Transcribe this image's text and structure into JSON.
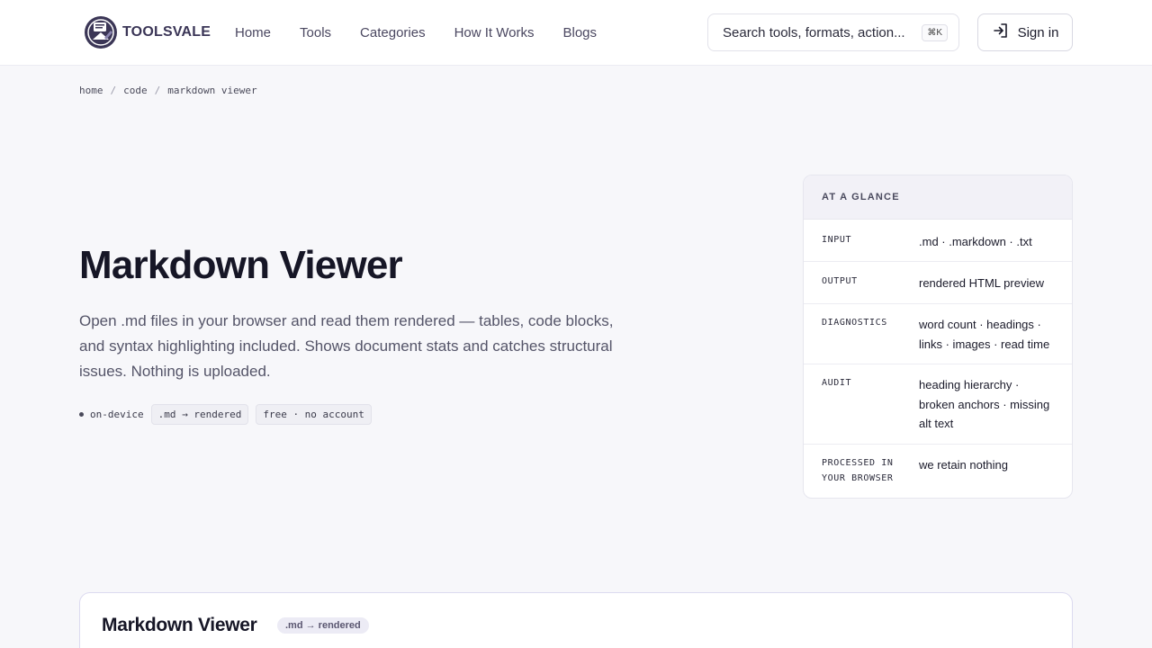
{
  "header": {
    "logo_text": "TOOLSVALE",
    "nav": [
      "Home",
      "Tools",
      "Categories",
      "How It Works",
      "Blogs"
    ],
    "search_placeholder": "Search tools, formats, action...",
    "search_shortcut": "⌘K",
    "signin_label": "Sign in"
  },
  "breadcrumb": [
    "home",
    "code",
    "markdown viewer"
  ],
  "hero": {
    "title": "Markdown Viewer",
    "description": "Open .md files in your browser and read them rendered — tables, code blocks, and syntax highlighting included. Shows document stats and catches structural issues. Nothing is uploaded.",
    "tags": [
      "on-device",
      ".md → rendered",
      "free · no account"
    ]
  },
  "glance": {
    "heading": "AT A GLANCE",
    "rows": [
      {
        "key": "INPUT",
        "value": ".md · .markdown · .txt"
      },
      {
        "key": "OUTPUT",
        "value": "rendered HTML preview"
      },
      {
        "key": "DIAGNOSTICS",
        "value": "word count · headings · links · images · read time"
      },
      {
        "key": "AUDIT",
        "value": "heading hierarchy · broken anchors · missing alt text"
      },
      {
        "key": "PROCESSED IN YOUR BROWSER",
        "value": "we retain nothing"
      }
    ]
  },
  "tool_card": {
    "title": "Markdown Viewer",
    "badge": ".md → rendered"
  }
}
